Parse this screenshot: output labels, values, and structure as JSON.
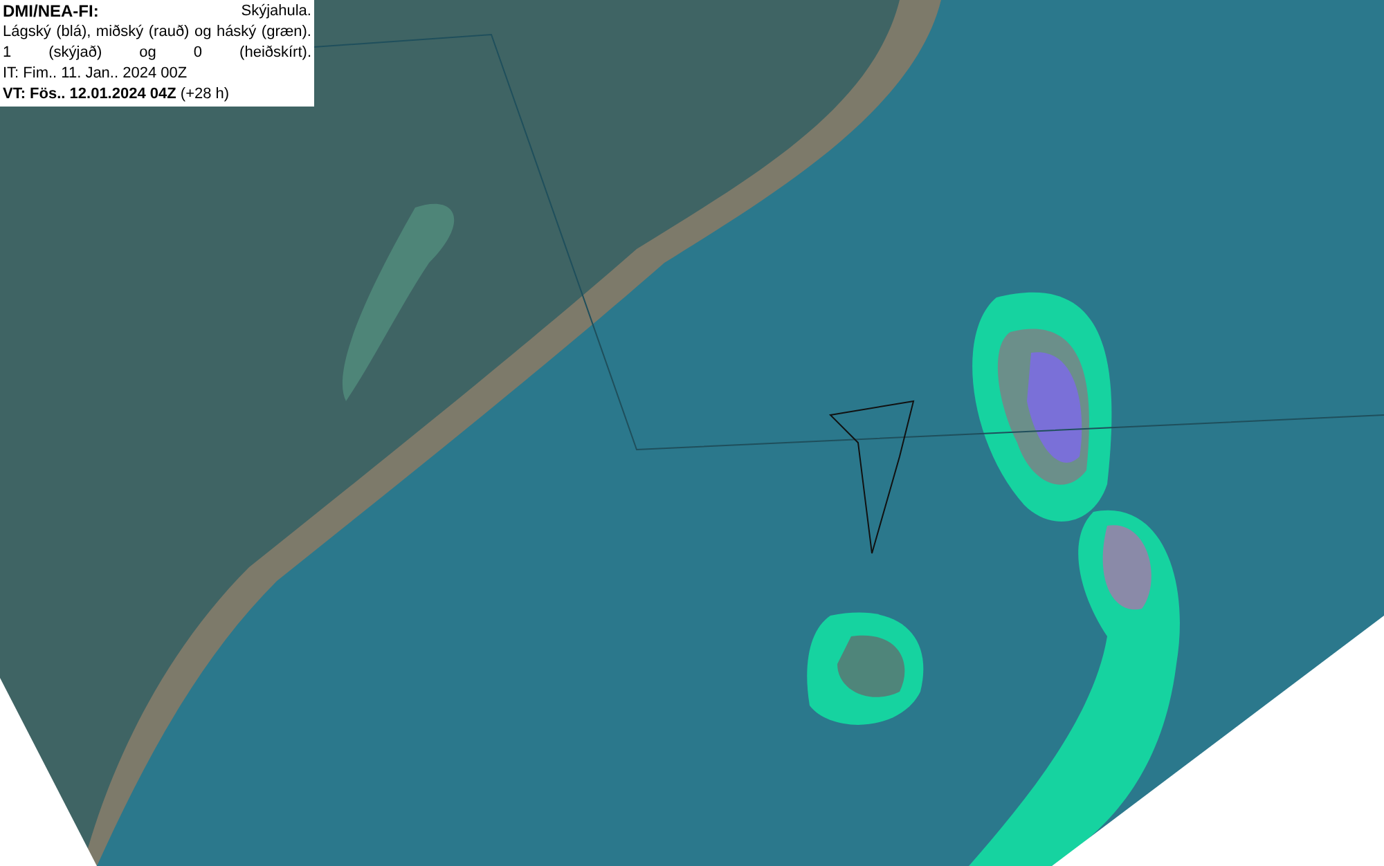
{
  "legend": {
    "title": "DMI/NEA-FI:",
    "subtitle": "Skýjahula.",
    "description": "Lágský (blá), miðský (rauð) og háský (græn). 1 (skýjað) og 0 (heiðskírt).",
    "initial_time": "IT: Fim.. 11. Jan.. 2024 00Z",
    "valid_time": "**VT: Fös.. 12.01.2024 04Z** (+28 h)"
  }
}
